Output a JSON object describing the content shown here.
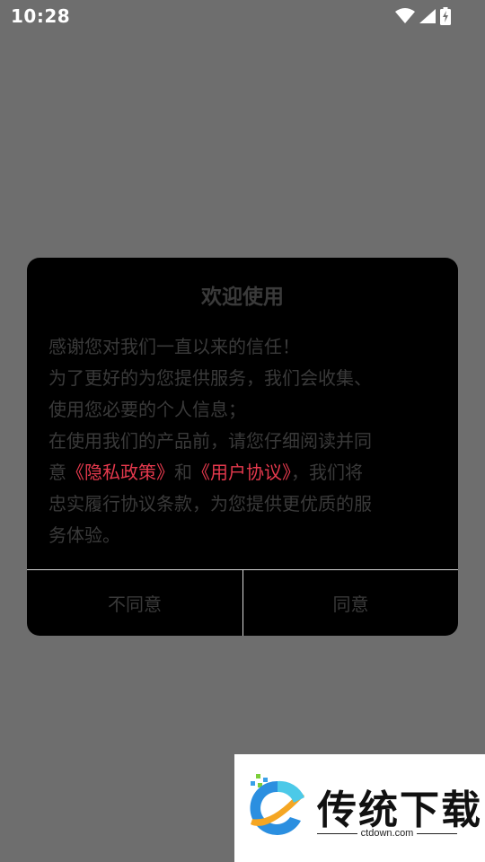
{
  "status_bar": {
    "time": "10:28",
    "icons": [
      "wifi-icon",
      "cellular-signal-icon",
      "battery-charging-icon"
    ]
  },
  "dialog": {
    "title": "欢迎使用",
    "lines": [
      "感谢您对我们一直以来的信任！",
      "为了更好的为您提供服务，我们会收集、",
      "使用您必要的个人信息；",
      "在使用我们的产品前，请您仔细阅读并同"
    ],
    "line5_prefix": "意",
    "privacy_link": "《隐私政策》",
    "line5_and": "和",
    "agreement_link": "《用户协议》",
    "line5_suffix": "，我们将",
    "lines_after": [
      "忠实履行协议条款，为您提供更优质的服",
      "务体验。"
    ],
    "disagree_label": "不同意",
    "agree_label": "同意"
  },
  "watermark": {
    "title": "传统下载",
    "url": "ctdown.com"
  },
  "colors": {
    "overlay_background": "#6e6e6e",
    "dialog_background": "#000000",
    "dialog_text": "#3a3a3a",
    "link": "#e5394d",
    "divider": "#d8d8d8"
  }
}
